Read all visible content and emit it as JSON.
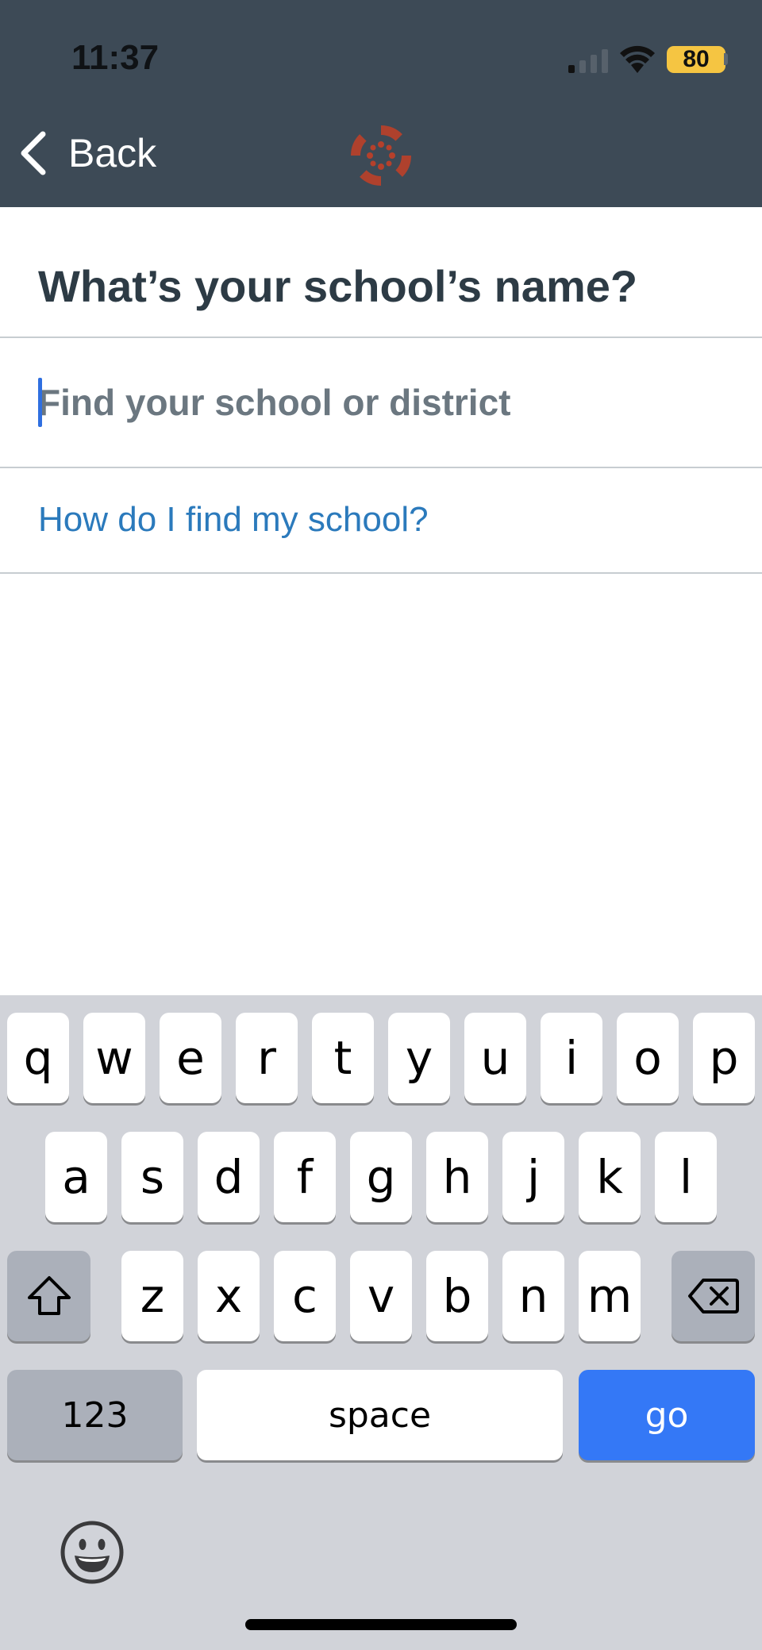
{
  "status_bar": {
    "time": "11:37",
    "battery": "80",
    "signal_icon": "cellular-signal-icon",
    "wifi_icon": "wifi-icon"
  },
  "nav": {
    "back_label": "Back",
    "logo": "canvas-logo-icon"
  },
  "main": {
    "title": "What’s your school’s name?",
    "search_placeholder": "Find your school or district",
    "search_value": "",
    "help_link": "How do I find my school?"
  },
  "keyboard": {
    "row1": [
      "q",
      "w",
      "e",
      "r",
      "t",
      "y",
      "u",
      "i",
      "o",
      "p"
    ],
    "row2": [
      "a",
      "s",
      "d",
      "f",
      "g",
      "h",
      "j",
      "k",
      "l"
    ],
    "row3": [
      "z",
      "x",
      "c",
      "v",
      "b",
      "n",
      "m"
    ],
    "numbers_label": "123",
    "space_label": "space",
    "go_label": "go",
    "shift_icon": "shift-icon",
    "delete_icon": "backspace-icon",
    "emoji_icon": "emoji-icon"
  },
  "colors": {
    "header": "#3d4a56",
    "title": "#2d3b45",
    "link": "#2b7abc",
    "logo": "#b5402b",
    "go_key": "#3478f6",
    "keyboard_bg": "#d1d3d9"
  }
}
